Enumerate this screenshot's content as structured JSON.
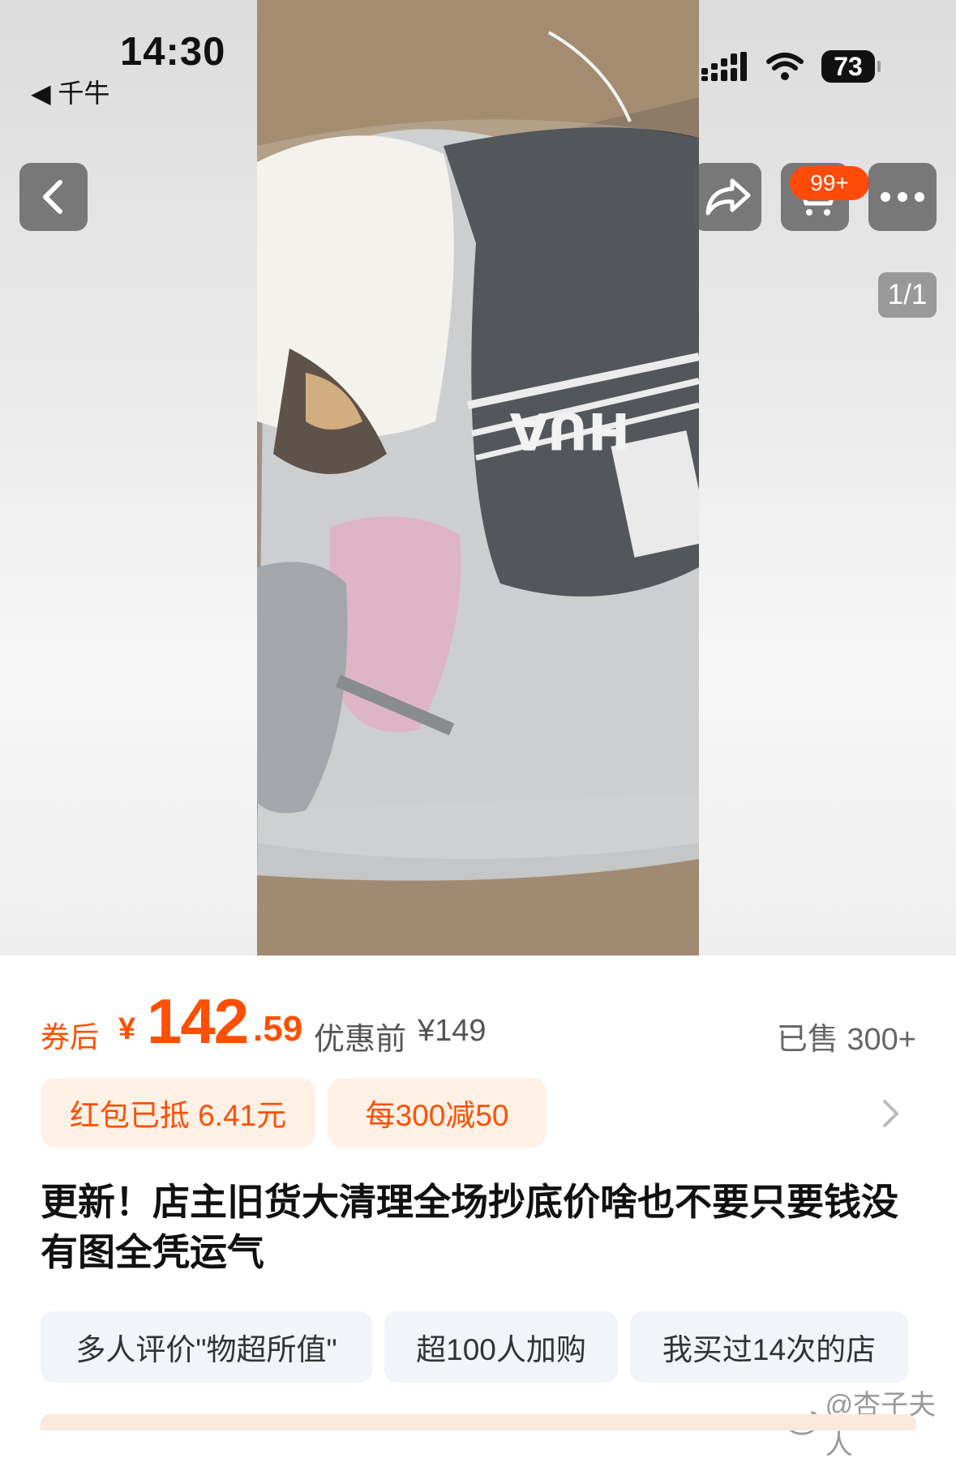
{
  "status_bar": {
    "time": "14:30",
    "back_app": "◀ 千牛",
    "battery": "73"
  },
  "top_nav": {
    "cart_badge": "99+",
    "page_counter": "1/1"
  },
  "price": {
    "after_label": "券后",
    "currency": "¥",
    "integer": "142",
    "decimal": ".59",
    "original_label": "优惠前",
    "original_price": "¥149",
    "sold": "已售 300+"
  },
  "promotions": [
    {
      "label": "红包已抵 6.41元"
    },
    {
      "label": "每300减50"
    }
  ],
  "product": {
    "title": "更新！店主旧货大清理全场抄底价啥也不要只要钱没有图全凭运气"
  },
  "tags": [
    {
      "label": "多人评价\"物超所值\""
    },
    {
      "label": "超100人加购"
    },
    {
      "label": "我买过14次的店"
    }
  ],
  "photo": {
    "bag_text": "HUA"
  },
  "watermark": "@杏子夫人",
  "colors": {
    "accent": "#ff4f00",
    "badge": "#ff4b0a",
    "promo_bg": "#fff1e6",
    "tag_bg": "#f1f4f9"
  },
  "icons": [
    "back-icon",
    "share-icon",
    "cart-icon",
    "more-icon",
    "chevron-right-icon",
    "signal-icon",
    "wifi-icon",
    "weibo-icon"
  ]
}
